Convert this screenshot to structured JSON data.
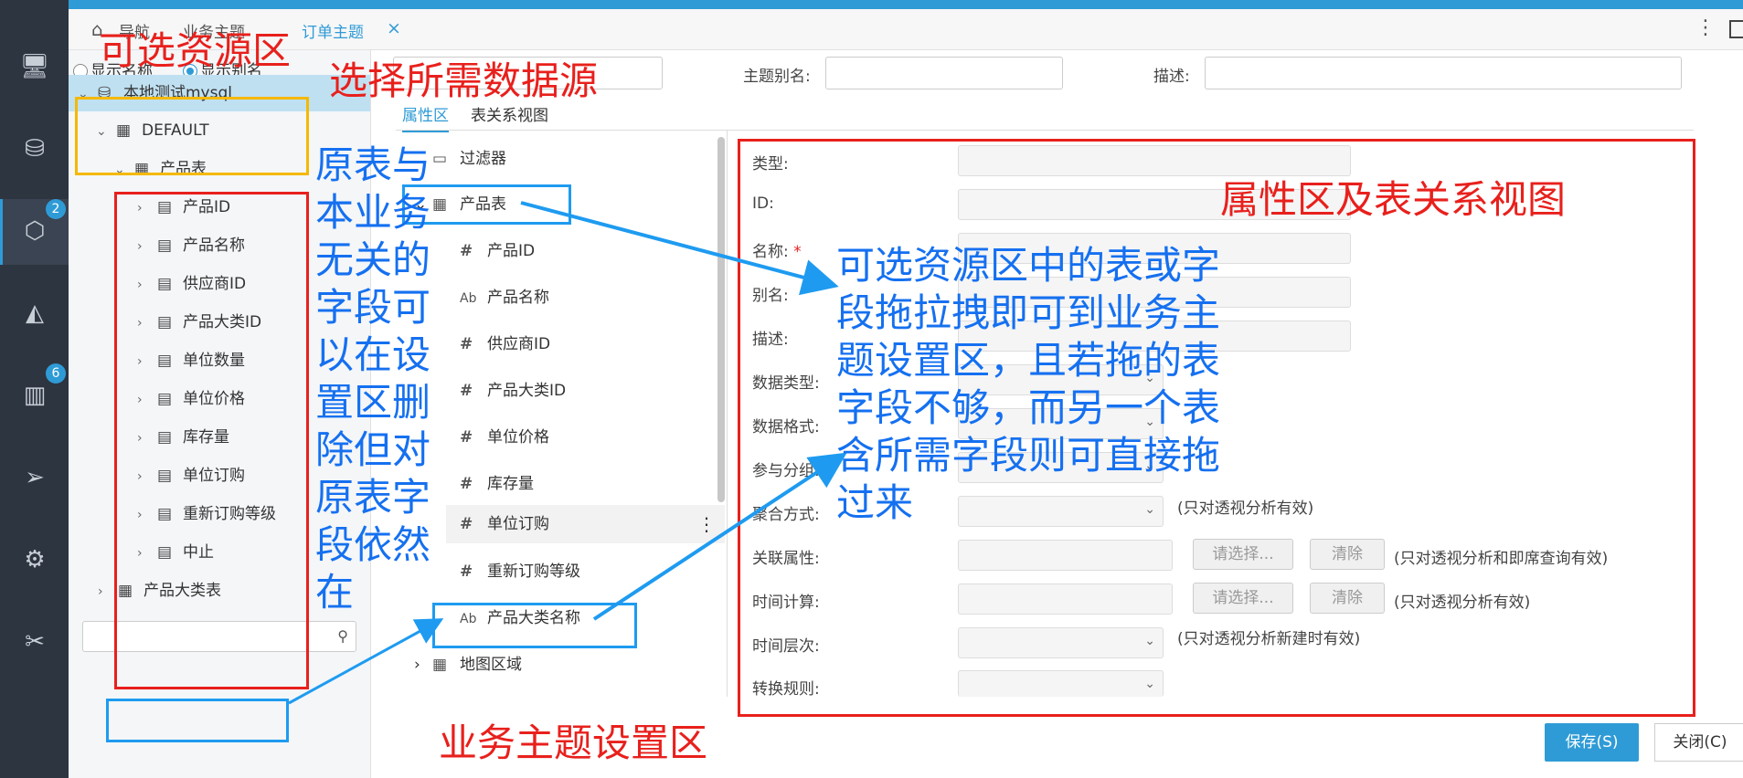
{
  "nav": {
    "icons": [
      "monitor-icon",
      "database-settings-icon",
      "cube-icon",
      "chart-compass-icon",
      "bar-chart-icon",
      "send-icon",
      "brain-settings-icon",
      "tools-icon"
    ],
    "badge_cube": "2",
    "badge_chart": "6"
  },
  "tabs": {
    "crumb_1": "导航",
    "crumb_2": "业务主题",
    "active_tab": "订单主题",
    "close": "×",
    "more": "⋮"
  },
  "resource": {
    "radio_name": "显示名称",
    "radio_alias": "显示别名",
    "db": "本地测试mysql",
    "schema": "DEFAULT",
    "table": "产品表",
    "fields": [
      "产品ID",
      "产品名称",
      "供应商ID",
      "产品大类ID",
      "单位数量",
      "单位价格",
      "库存量",
      "单位订购",
      "重新订购等级",
      "中止"
    ],
    "table2": "产品大类表",
    "search_placeholder": ""
  },
  "header_form": {
    "alias_label": "主题别名:",
    "desc_label": "描述:"
  },
  "subtabs": {
    "attr": "属性区",
    "rel": "表关系视图"
  },
  "middle": {
    "filter": "过滤器",
    "table": "产品表",
    "fields": [
      {
        "type": "#",
        "name": "产品ID"
      },
      {
        "type": "Ab",
        "name": "产品名称"
      },
      {
        "type": "#",
        "name": "供应商ID"
      },
      {
        "type": "#",
        "name": "产品大类ID"
      },
      {
        "type": "#",
        "name": "单位价格"
      },
      {
        "type": "#",
        "name": "库存量"
      },
      {
        "type": "#",
        "name": "单位订购"
      },
      {
        "type": "#",
        "name": "重新订购等级"
      },
      {
        "type": "Ab",
        "name": "产品大类名称"
      }
    ],
    "region": "地图区域"
  },
  "props": {
    "type": "类型:",
    "id": "ID:",
    "name": "名称:",
    "required": "*",
    "alias": "别名:",
    "desc": "描述:",
    "data_type": "数据类型:",
    "data_format": "数据格式:",
    "group": "参与分组:",
    "agg": "聚合方式:",
    "agg_note": "(只对透视分析有效)",
    "rel_attr": "关联属性:",
    "time_calc": "时间计算:",
    "time_level": "时间层次:",
    "convert": "转换规则:",
    "choose": "请选择...",
    "clear": "清除",
    "rel_note": "(只对透视分析和即席查询有效)",
    "time_note": "(只对透视分析有效)",
    "level_note": "(只对透视分析新建时有效)"
  },
  "footer": {
    "save": "保存(S)",
    "close": "关闭(C)"
  },
  "annotations": {
    "resource_area": "可选资源区",
    "select_source": "选择所需数据源",
    "property_area": "属性区及表关系视图",
    "setting_area": "业务主题设置区",
    "left_note": "原表与本业务无关的字段可以在设置区删除但对原表字段依然在",
    "drag_note": "可选资源区中的表或字段拖拉拽即可到业务主题设置区，且若拖的表字段不够，而另一个表含所需字段则可直接拖过来"
  }
}
